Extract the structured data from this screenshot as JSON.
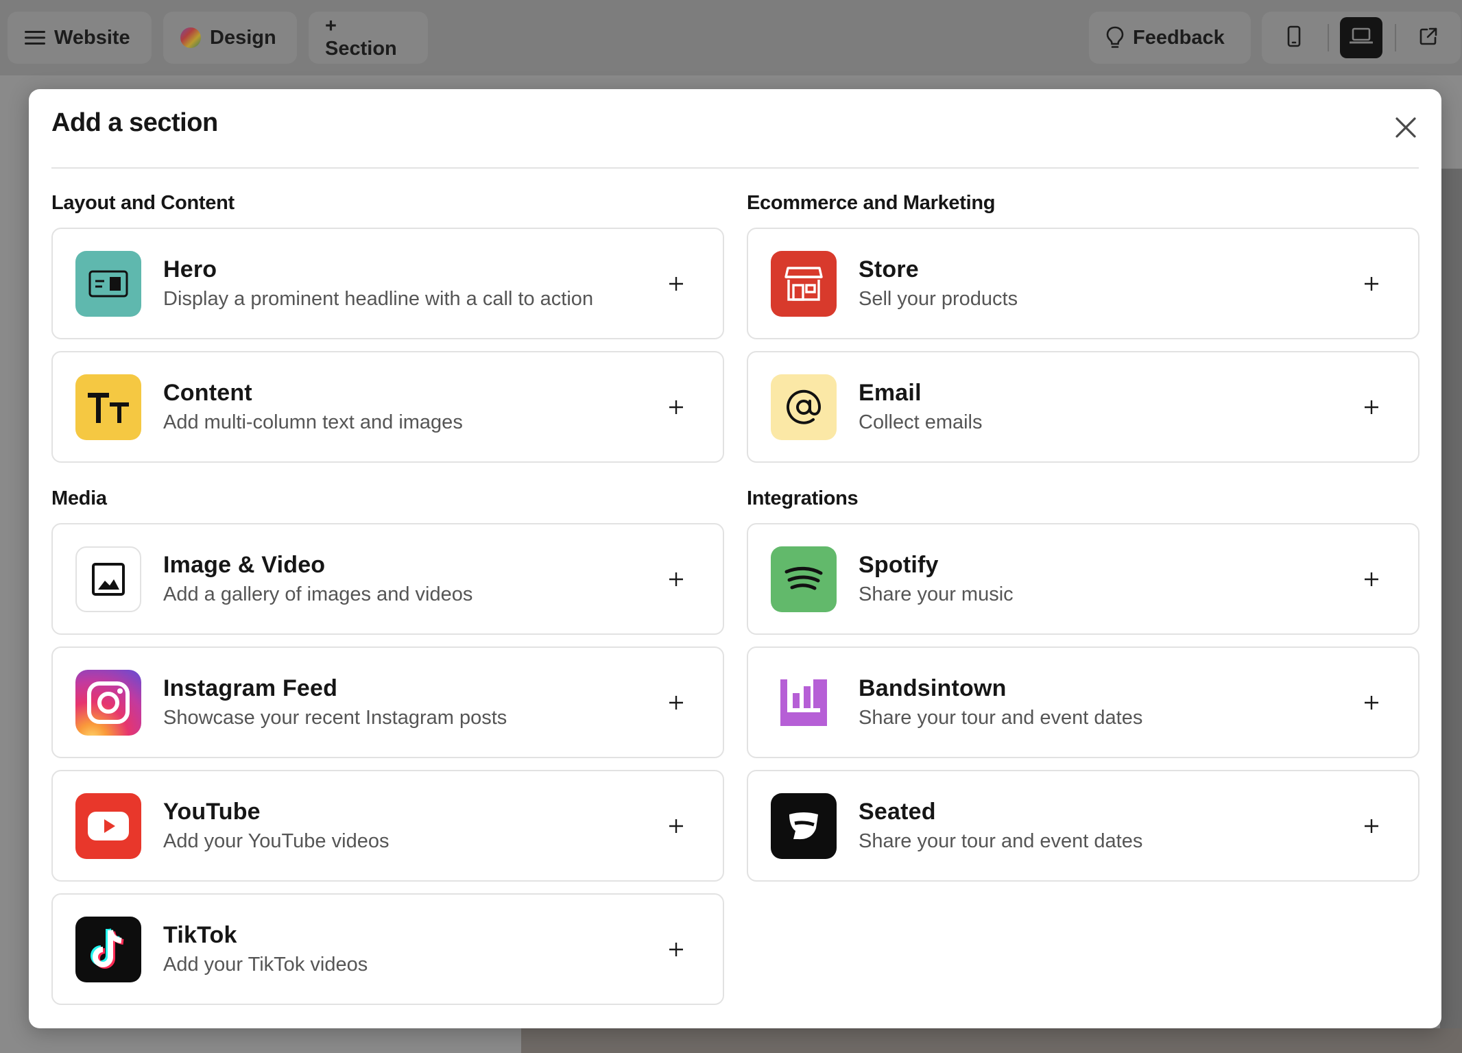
{
  "topbar": {
    "website_label": "Website",
    "design_label": "Design",
    "section_label": "+ Section",
    "feedback_label": "Feedback"
  },
  "modal": {
    "title": "Add a section",
    "groups": {
      "layout": {
        "title": "Layout and Content",
        "items": [
          {
            "name": "Hero",
            "desc": "Display a prominent headline with a call to action",
            "icon": "hero-icon"
          },
          {
            "name": "Content",
            "desc": "Add multi-column text and images",
            "icon": "text-size-icon"
          }
        ]
      },
      "ecommerce": {
        "title": "Ecommerce and Marketing",
        "items": [
          {
            "name": "Store",
            "desc": "Sell your products",
            "icon": "store-icon"
          },
          {
            "name": "Email",
            "desc": "Collect emails",
            "icon": "at-sign-icon"
          }
        ]
      },
      "media": {
        "title": "Media",
        "items": [
          {
            "name": "Image & Video",
            "desc": "Add a gallery of images and videos",
            "icon": "image-icon"
          },
          {
            "name": "Instagram Feed",
            "desc": "Showcase your recent Instagram posts",
            "icon": "instagram-icon"
          },
          {
            "name": "YouTube",
            "desc": "Add your YouTube videos",
            "icon": "youtube-icon"
          },
          {
            "name": "TikTok",
            "desc": "Add your TikTok videos",
            "icon": "tiktok-icon"
          }
        ]
      },
      "integrations": {
        "title": "Integrations",
        "items": [
          {
            "name": "Spotify",
            "desc": "Share your music",
            "icon": "spotify-icon"
          },
          {
            "name": "Bandsintown",
            "desc": "Share your tour and event dates",
            "icon": "bandsintown-icon"
          },
          {
            "name": "Seated",
            "desc": "Share your tour and event dates",
            "icon": "seated-icon"
          }
        ]
      }
    }
  },
  "colors": {
    "hero": "#5fb8ae",
    "content": "#f5c842",
    "store": "#d83a2c",
    "email": "#fbe8a6",
    "spotify": "#62b96b",
    "bandsintown": "#b65fd6",
    "youtube": "#e8372b",
    "seated": "#0d0d0d",
    "tiktok": "#0d0d0d"
  }
}
